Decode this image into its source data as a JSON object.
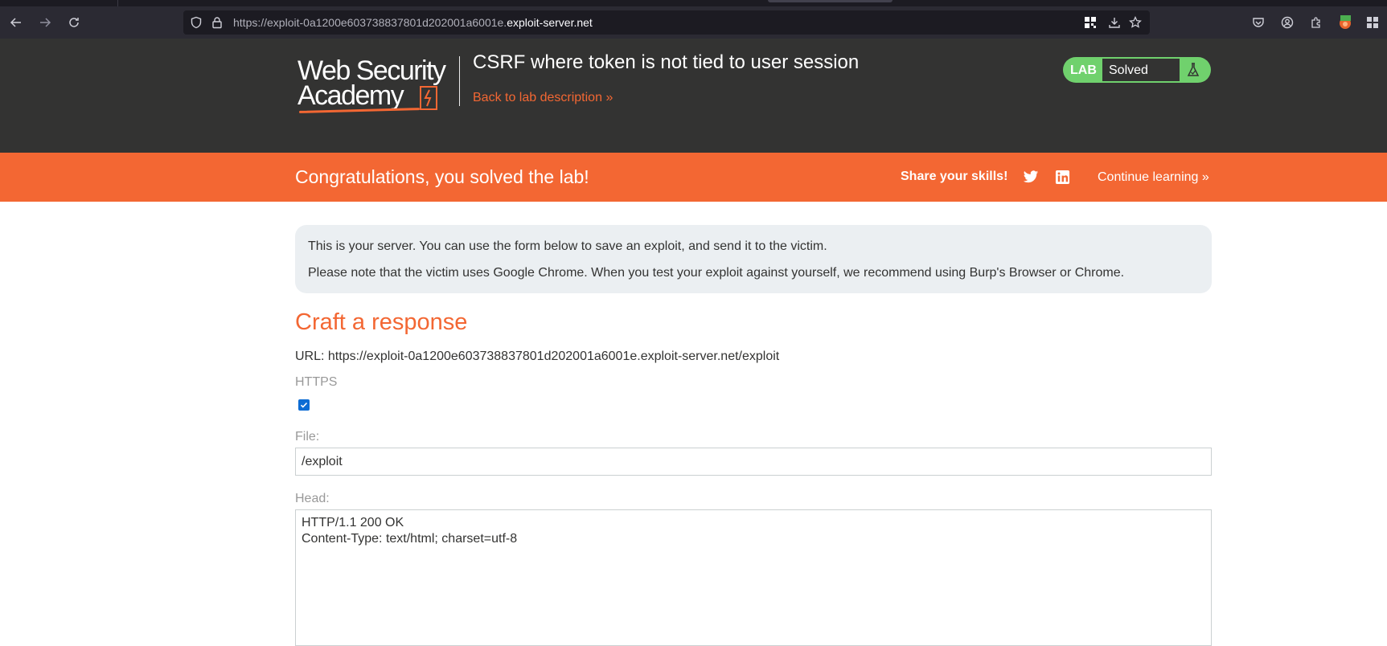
{
  "browser": {
    "url_prefix": "https://exploit-0a1200e603738837801d202001a6001e.",
    "url_domain": "exploit-server.net",
    "icons": [
      "back-icon",
      "forward-icon",
      "reload-icon",
      "shield-icon",
      "lock-icon",
      "qr-code-icon",
      "download-icon",
      "bookmark-star-icon",
      "pocket-icon",
      "account-icon",
      "extensions-icon",
      "burp-extension-icon",
      "menu-icon"
    ]
  },
  "header": {
    "logo_line1": "Web Security",
    "logo_line2": "Academy",
    "lab_title": "CSRF where token is not tied to user session",
    "back_link": "Back to lab description",
    "back_chevrons": "»",
    "badge_label": "LAB",
    "badge_status": "Solved",
    "colors": {
      "dark": "#333332",
      "accent": "#f36733",
      "solved_green": "#70d16d"
    }
  },
  "banner": {
    "congrats": "Congratulations, you solved the lab!",
    "share_label": "Share your skills!",
    "continue_label": "Continue learning",
    "continue_chevrons": "»"
  },
  "main": {
    "info_line1": "This is your server. You can use the form below to save an exploit, and send it to the victim.",
    "info_line2": "Please note that the victim uses Google Chrome. When you test your exploit against yourself, we recommend using Burp's Browser or Chrome.",
    "heading": "Craft a response",
    "url_line": "URL: https://exploit-0a1200e603738837801d202001a6001e.exploit-server.net/exploit",
    "https_label": "HTTPS",
    "https_checked": true,
    "file_label": "File:",
    "file_value": "/exploit",
    "head_label": "Head:",
    "head_line1": "HTTP/1.1 200 OK",
    "head_line2": "Content-Type: text/html; charset=utf-8"
  }
}
